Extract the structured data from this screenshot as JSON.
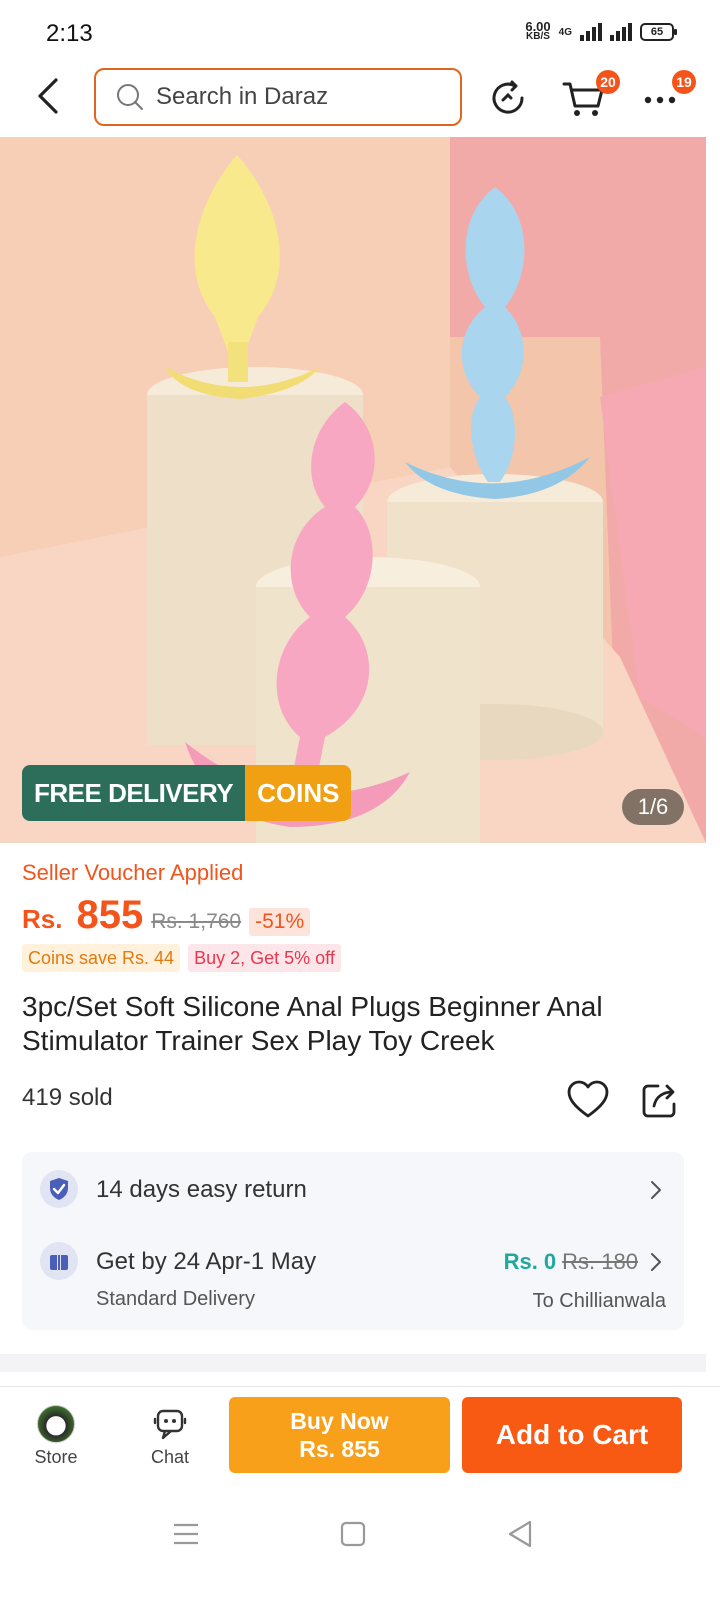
{
  "status_bar": {
    "time": "2:13",
    "net_speed": "6.00",
    "net_unit": "KB/S",
    "network_type": "4G",
    "battery": "65"
  },
  "header": {
    "search_placeholder": "Search in Daraz",
    "cart_badge": "20",
    "more_badge": "19"
  },
  "gallery": {
    "promo_free_delivery": "FREE DELIVERY",
    "promo_coins": "COINS",
    "counter": "1/6"
  },
  "product": {
    "voucher_text": "Seller Voucher Applied",
    "currency": "Rs.",
    "price": "855",
    "original_price": "Rs. 1,760",
    "discount": "-51%",
    "coins_chip": "Coins save Rs. 44",
    "bundle_chip": "Buy 2, Get 5% off",
    "title": "3pc/Set Soft Silicone Anal Plugs Beginner Anal Stimulator Trainer Sex Play Toy Creek",
    "sold": "419 sold"
  },
  "services": {
    "return_text": "14 days easy return",
    "delivery_text": "Get by 24 Apr-1 May",
    "delivery_type": "Standard Delivery",
    "fee_now": "Rs. 0",
    "fee_was": "Rs. 180",
    "destination": "To Chillianwala"
  },
  "actions": {
    "store_label": "Store",
    "chat_label": "Chat",
    "buy_now_label": "Buy Now",
    "buy_now_price": "Rs. 855",
    "add_to_cart_label": "Add to Cart"
  },
  "colors": {
    "brand_orange": "#f85a14",
    "buy_now_yellow": "#f9a01b",
    "free_delivery_green": "#2d6e5a",
    "teal_fee": "#1fa99d"
  }
}
